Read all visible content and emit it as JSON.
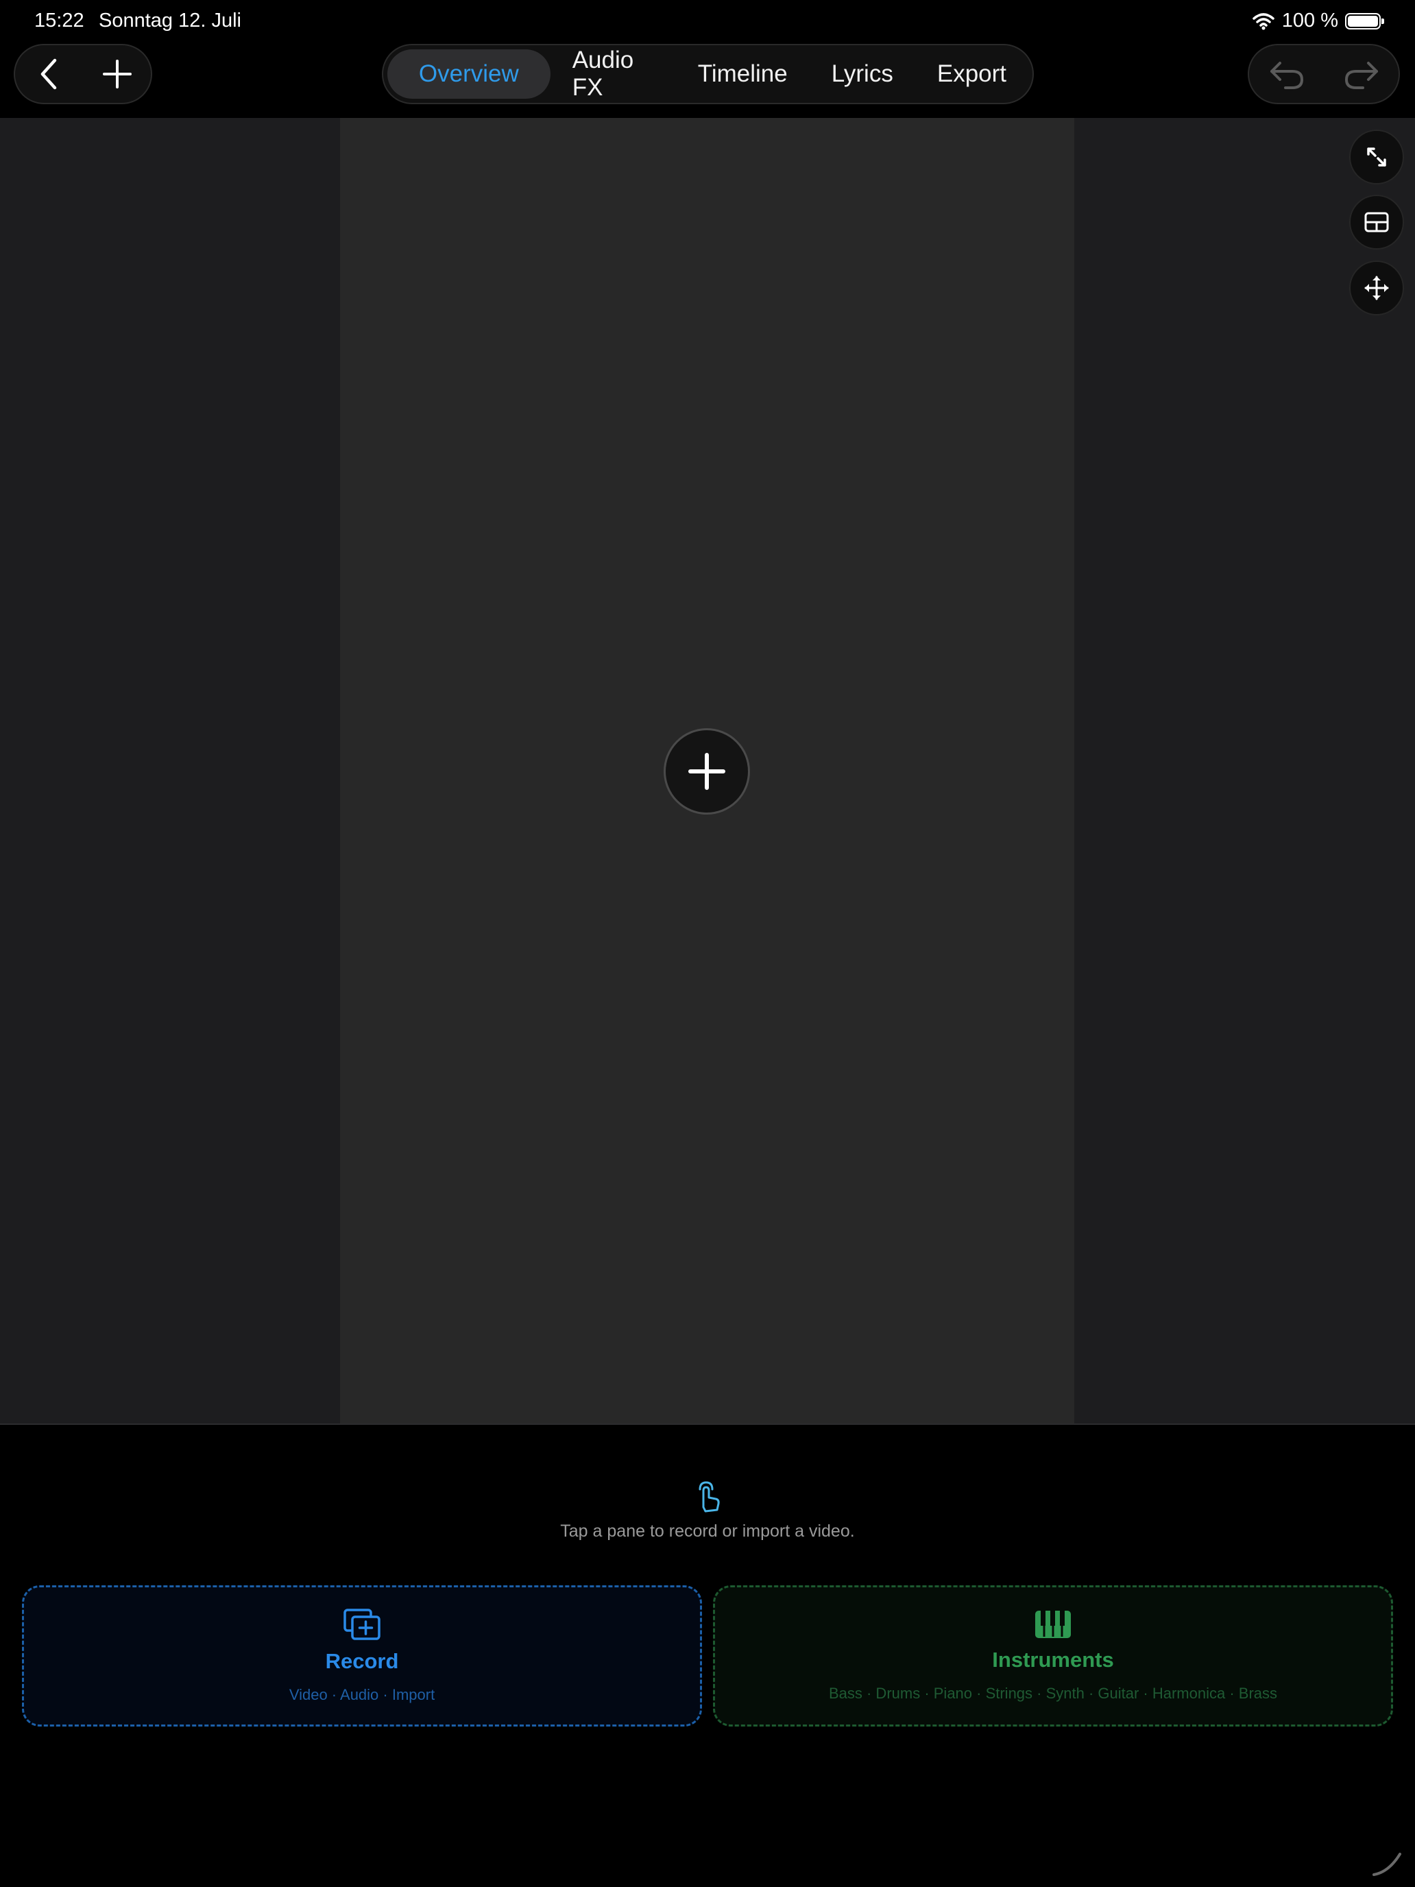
{
  "status_bar": {
    "time": "15:22",
    "date": "Sonntag 12. Juli",
    "battery_label": "100 %",
    "battery_level": 1.0
  },
  "toolbar": {
    "back_icon": "chevron-left-icon",
    "add_icon": "plus-icon",
    "undo_icon": "undo-icon",
    "redo_icon": "redo-icon",
    "tabs": [
      {
        "label": "Overview",
        "active": true
      },
      {
        "label": "Audio FX",
        "active": false
      },
      {
        "label": "Timeline",
        "active": false
      },
      {
        "label": "Lyrics",
        "active": false
      },
      {
        "label": "Export",
        "active": false
      }
    ]
  },
  "canvas": {
    "side_buttons": [
      "expand-icon",
      "grid-layout-icon",
      "move-icon"
    ],
    "add_pane_icon": "plus-icon"
  },
  "hint": {
    "icon": "tap-hand-icon",
    "text": "Tap a pane to record or import a video."
  },
  "cards": {
    "record": {
      "icon": "add-media-icon",
      "title": "Record",
      "subtitle": "Video · Audio · Import"
    },
    "instruments": {
      "icon": "piano-keys-icon",
      "title": "Instruments",
      "subtitle": "Bass · Drums · Piano · Strings · Synth · Guitar · Harmonica · Brass"
    }
  },
  "colors": {
    "accent_blue": "#2f9bea",
    "accent_green": "#2f9a52",
    "background": "#000000",
    "pane": "#282828"
  }
}
